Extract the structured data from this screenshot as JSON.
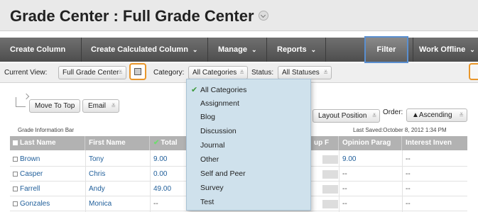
{
  "page": {
    "title": "Grade Center : Full Grade Center"
  },
  "action_bar": {
    "items": [
      "Create Column",
      "Create Calculated Column",
      "Manage",
      "Reports"
    ],
    "filter": "Filter",
    "work_offline": "Work Offline",
    "caret": "⌄"
  },
  "filter_bar": {
    "current_view_label": "Current View:",
    "current_view_value": "Full Grade Center",
    "category_label": "Category:",
    "category_value": "All Categories",
    "status_label": "Status:",
    "status_value": "All Statuses"
  },
  "toolbar": {
    "move_to_top": "Move To Top",
    "email": "Email",
    "layout_position": "Layout Position",
    "order_label": "Order:",
    "order_value": "▲Ascending",
    "grade_info_bar": "Grade Information Bar",
    "last_saved": "Last Saved:October 8, 2012 1:34 PM"
  },
  "grid": {
    "columns": [
      "Last Name",
      "First Name",
      "Total",
      "up F",
      "Opinion Parag",
      "Interest Inven"
    ],
    "rows": [
      {
        "last": "Brown",
        "first": "Tony",
        "total": "9.00",
        "opinion": "9.00",
        "interest": "--"
      },
      {
        "last": "Casper",
        "first": "Chris",
        "total": "0.00",
        "opinion": "--",
        "interest": "--"
      },
      {
        "last": "Farrell",
        "first": "Andy",
        "total": "49.00",
        "opinion": "--",
        "interest": "--"
      },
      {
        "last": "Gonzales",
        "first": "Monica",
        "total": "--",
        "opinion": "--",
        "interest": "--"
      }
    ]
  },
  "category_dropdown": {
    "options": [
      "All Categories",
      "Assignment",
      "Blog",
      "Discussion",
      "Journal",
      "Other",
      "Self and Peer",
      "Survey",
      "Test"
    ],
    "selected_check": "✔"
  },
  "icons": {
    "dropdown_arrow": "≚"
  }
}
